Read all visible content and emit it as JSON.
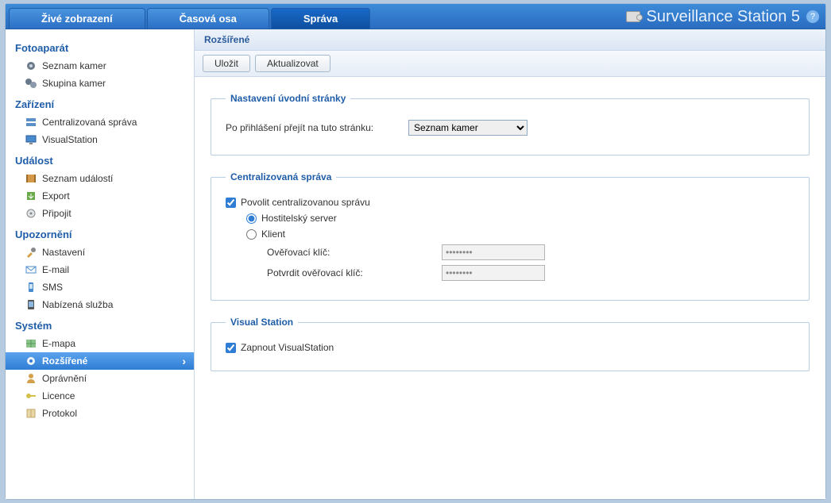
{
  "app": {
    "title": "Surveillance Station 5"
  },
  "tabs": {
    "live": "Živé zobrazení",
    "timeline": "Časová osa",
    "manage": "Správa"
  },
  "sidebar": {
    "sections": [
      {
        "title": "Fotoaparát",
        "items": [
          {
            "id": "camera-list",
            "label": "Seznam kamer",
            "icon": "camera-icon"
          },
          {
            "id": "camera-group",
            "label": "Skupina kamer",
            "icon": "camera-group-icon"
          }
        ]
      },
      {
        "title": "Zařízení",
        "items": [
          {
            "id": "central-mgmt",
            "label": "Centralizovaná správa",
            "icon": "server-icon"
          },
          {
            "id": "visualstation",
            "label": "VisualStation",
            "icon": "monitor-icon"
          }
        ]
      },
      {
        "title": "Událost",
        "items": [
          {
            "id": "event-list",
            "label": "Seznam událostí",
            "icon": "film-icon"
          },
          {
            "id": "export",
            "label": "Export",
            "icon": "export-icon"
          },
          {
            "id": "mount",
            "label": "Připojit",
            "icon": "mount-icon"
          }
        ]
      },
      {
        "title": "Upozornění",
        "items": [
          {
            "id": "notif-settings",
            "label": "Nastavení",
            "icon": "wrench-icon"
          },
          {
            "id": "email",
            "label": "E-mail",
            "icon": "mail-icon"
          },
          {
            "id": "sms",
            "label": "SMS",
            "icon": "phone-icon"
          },
          {
            "id": "push",
            "label": "Nabízená služba",
            "icon": "device-icon"
          }
        ]
      },
      {
        "title": "Systém",
        "items": [
          {
            "id": "emap",
            "label": "E-mapa",
            "icon": "map-icon"
          },
          {
            "id": "advanced",
            "label": "Rozšířené",
            "icon": "gear-icon",
            "selected": true
          },
          {
            "id": "privilege",
            "label": "Oprávnění",
            "icon": "user-icon"
          },
          {
            "id": "license",
            "label": "Licence",
            "icon": "key-icon"
          },
          {
            "id": "log",
            "label": "Protokol",
            "icon": "book-icon"
          }
        ]
      }
    ]
  },
  "panel": {
    "title": "Rozšířené",
    "toolbar": {
      "save": "Uložit",
      "refresh": "Aktualizovat"
    },
    "homepage": {
      "legend": "Nastavení úvodní stránky",
      "label": "Po přihlášení přejít na tuto stránku:",
      "selected": "Seznam kamer"
    },
    "central": {
      "legend": "Centralizovaná správa",
      "enable": "Povolit centralizovanou správu",
      "enable_checked": true,
      "host": "Hostitelský server",
      "client": "Klient",
      "mode": "host",
      "verify_key": "Ověřovací klíč:",
      "confirm_key": "Potvrdit ověřovací klíč:",
      "key_value": "••••••••",
      "confirm_value": "••••••••"
    },
    "vs": {
      "legend": "Visual Station",
      "enable": "Zapnout VisualStation",
      "enable_checked": true
    }
  }
}
